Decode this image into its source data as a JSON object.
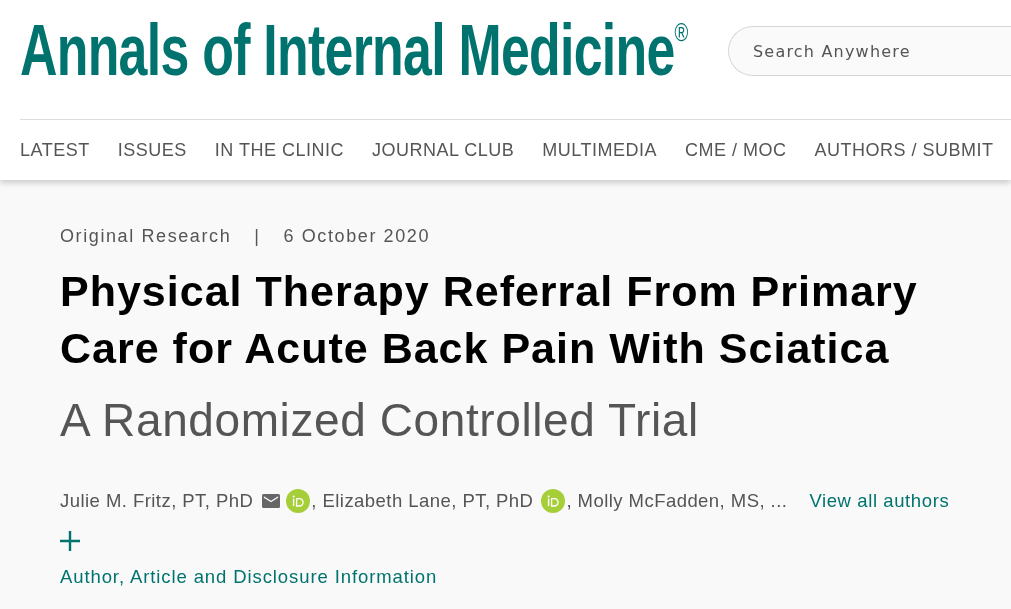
{
  "header": {
    "logo": "Annals of Internal Medicine$^{®}$",
    "search": {
      "placeholder": "Search Anywhere"
    }
  },
  "nav": [
    "LATEST",
    "ISSUES",
    "IN THE CLINIC",
    "JOURNAL CLUB",
    "MULTIMEDIA",
    "CME / MOC",
    "AUTHORS / SUBMIT"
  ],
  "article": {
    "type": "Original Research",
    "separator": "|",
    "date": "6 October 2020",
    "title": "Physical Therapy Referral From Primary Care for Acute Back Pain With Sciatica",
    "subtitle": "A Randomized Controlled Trial",
    "authors": [
      {
        "text": "Julie M. Fritz, PT, PhD",
        "email": true,
        "orcid": true
      },
      {
        "text": ", Elizabeth Lane, PT, PhD",
        "email": false,
        "orcid": true
      },
      {
        "text": ", Molly McFadden, MS, ...",
        "email": false,
        "orcid": false
      }
    ],
    "view_all": "View all authors",
    "info_link": "Author, Article and Disclosure Information"
  }
}
